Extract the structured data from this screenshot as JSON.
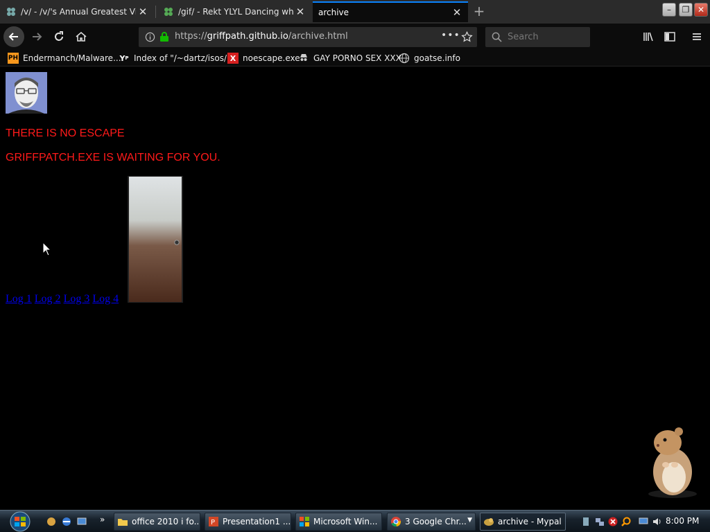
{
  "browser": {
    "tabs": [
      {
        "label": "/v/ - /v/'s Annual Greatest Vid",
        "active": false,
        "icon": "4chan-clover-icon"
      },
      {
        "label": "/gif/ - Rekt YLYL Dancing whil",
        "active": false,
        "icon": "4chan-clover-icon"
      },
      {
        "label": "archive",
        "active": true,
        "icon": ""
      }
    ],
    "url": {
      "scheme": "https://",
      "host": "griffpath.github.io",
      "path": "/archive.html"
    },
    "search_placeholder": "Search",
    "bookmarks": [
      {
        "label": "Endermanch/Malware...",
        "icon_text": "PH",
        "icon_color": "#f7971d"
      },
      {
        "label": "Index of \"/~dartz/isos/\"",
        "icon_text": "Y",
        "icon_color": "#ffffff"
      },
      {
        "label": "noescape.exe",
        "icon_text": "X",
        "icon_color": "#d62020"
      },
      {
        "label": "GAY PORNO SEX XXX",
        "icon_text": "",
        "icon_color": "#cccccc"
      },
      {
        "label": "goatse.info",
        "icon_text": "",
        "icon_color": "#cccccc"
      }
    ]
  },
  "page": {
    "line1": "THERE IS NO ESCAPE",
    "line2": "GRIFFPATCH.EXE IS WAITING FOR YOU.",
    "text_color": "#ff1a1a",
    "link_color": "#0000ee",
    "logs": [
      "Log 1",
      "Log 2",
      "Log 3",
      "Log 4"
    ]
  },
  "taskbar": {
    "buttons": [
      {
        "label": "office 2010 i fo...",
        "icon": "folder-icon"
      },
      {
        "label": "Presentation1 ...",
        "icon": "powerpoint-icon"
      },
      {
        "label": "Microsoft Win...",
        "icon": "windows-flag-icon"
      },
      {
        "label": "3  Google Chr...",
        "icon": "chrome-icon"
      },
      {
        "label": "archive - Mypal",
        "icon": "mypal-icon",
        "active": true
      }
    ],
    "clock": "8:00 PM"
  }
}
